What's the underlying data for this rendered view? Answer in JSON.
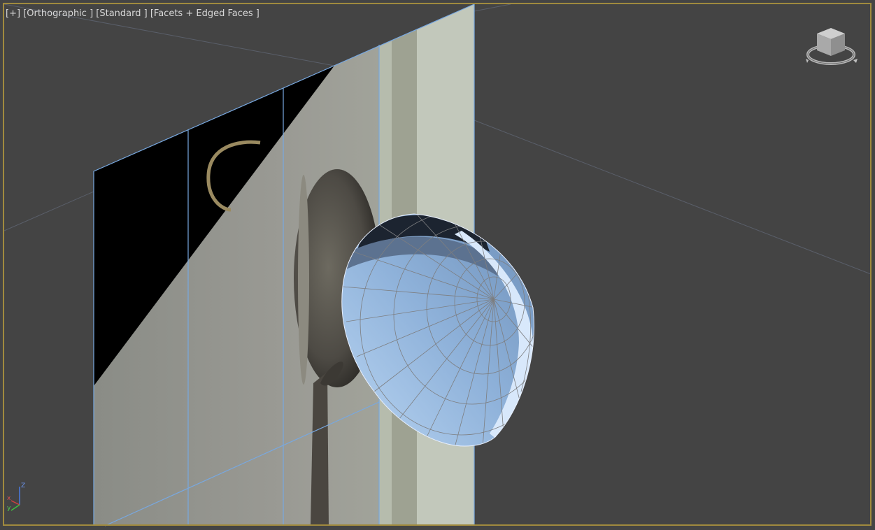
{
  "viewport": {
    "labels": {
      "plus": "[+]",
      "view": "[Orthographic ]",
      "shading": "[Standard ]",
      "display": "[Facets + Edged Faces ]"
    },
    "active_border_color": "#a08a3e",
    "background_color": "#444444"
  },
  "axis_tripod": {
    "z": "Z",
    "x": "x",
    "y": "y"
  },
  "viewcube": {
    "icon": "viewcube-icon"
  }
}
